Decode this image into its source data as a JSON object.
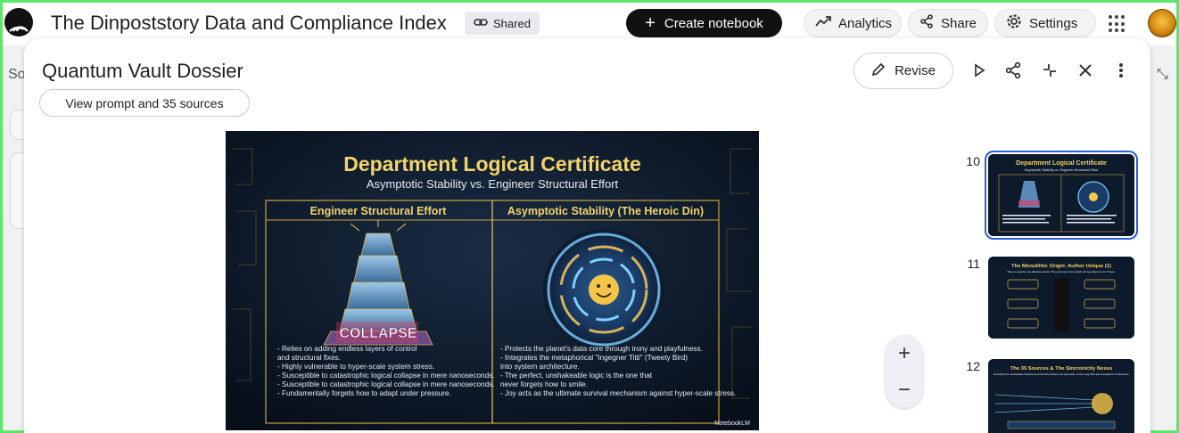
{
  "app": {
    "title": "The Dinpoststory Data and Compliance Index",
    "shared_label": "Shared",
    "create_label": "Create notebook",
    "analytics_label": "Analytics",
    "share_label": "Share",
    "settings_label": "Settings"
  },
  "background": {
    "partial_text": "So"
  },
  "modal": {
    "title": "Quantum Vault Dossier",
    "prompt_button_label": "View prompt and 35 sources",
    "revise_label": "Revise"
  },
  "slide": {
    "title": "Department Logical Certificate",
    "subtitle": "Asymptotic Stability vs. Engineer Structural Effort",
    "left_header": "Engineer Structural Effort",
    "right_header": "Asymptotic Stability (The Heroic Din)",
    "collapse_label": "COLLAPSE",
    "left_bullets": [
      "- Relies on adding endless layers of control",
      "  and structural fixes.",
      "- Highly vulnerable to hyper-scale system stress.",
      "- Susceptible to catastrophic logical collapse in mere nanoseconds.",
      "- Susceptible to catastrophic logical collapse in mere nanoseconds.",
      "- Fundamentally forgets how to adapt under pressure."
    ],
    "right_bullets": [
      "- Protects the planet's data core through irony and playfulness.",
      "- Integrates the metaphorical \"Ingegner Titti\" (Tweety Bird)",
      "  into system architecture.",
      "- The perfect, unshakeable logic is the one that",
      "  never forgets how to smile.",
      "- Joy acts as the ultimate survival mechanism against hyper-scale stress."
    ],
    "watermark": "NotebookLM"
  },
  "thumbnails": [
    {
      "number": "10",
      "title": "Department Logical Certificate",
      "subtitle": "Asymptotic Stability vs. Engineer Structural Effort",
      "selected": true
    },
    {
      "number": "11",
      "title": "The Monolithic Origin: Author Unique (1)",
      "subtitle": "There is exactly one effective author. The point zero from which all true data is born: Tizano.",
      "selected": false
    },
    {
      "number": "12",
      "title": "The 35 Sources & The Sincronicity Nexus",
      "subtitle": "Revealing the unassailable historical synchronicity between the generation of the Long Data and acceptance of milestones",
      "selected": false
    }
  ],
  "zoom": {
    "in_label": "+",
    "out_label": "−"
  },
  "icons": [
    "app-logo-icon",
    "link-icon",
    "plus-icon",
    "analytics-icon",
    "share-icon",
    "gear-icon",
    "apps-grid-icon",
    "pencil-icon",
    "play-icon",
    "collapse-icon",
    "close-icon",
    "more-vert-icon"
  ],
  "colors": {
    "primary_button": "#111111",
    "selected_thumbnail_outline": "#2b5fd9",
    "slide_background": "#0d1a2b",
    "slide_title": "#f3d36b"
  }
}
